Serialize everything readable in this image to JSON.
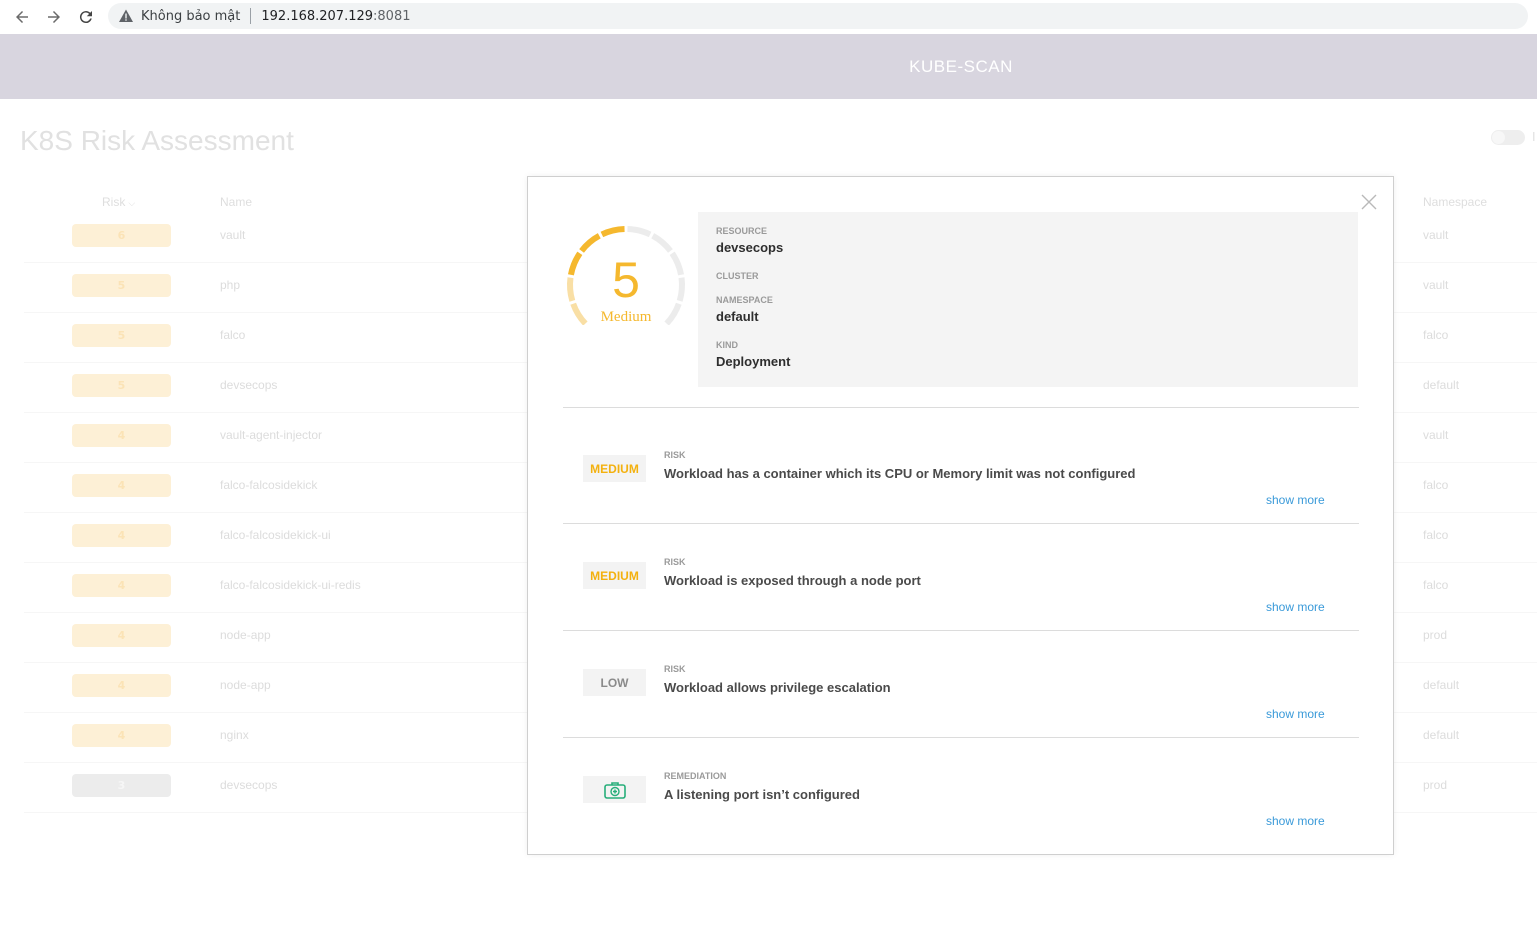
{
  "browser": {
    "security_label": "Không bảo mật",
    "url_host": "192.168.207.129",
    "url_port": ":8081"
  },
  "header": {
    "title": "KUBE-SCAN"
  },
  "page": {
    "title": "K8S Risk Assessment",
    "toggle_label": "I"
  },
  "table": {
    "columns": {
      "risk": "Risk",
      "name": "Name",
      "namespace": "Namespace"
    },
    "rows": [
      {
        "risk": "6",
        "name": "vault",
        "namespace": "vault"
      },
      {
        "risk": "5",
        "name": "php",
        "namespace": "vault"
      },
      {
        "risk": "5",
        "name": "falco",
        "namespace": "falco"
      },
      {
        "risk": "5",
        "name": "devsecops",
        "namespace": "default"
      },
      {
        "risk": "4",
        "name": "vault-agent-injector",
        "namespace": "vault"
      },
      {
        "risk": "4",
        "name": "falco-falcosidekick",
        "namespace": "falco"
      },
      {
        "risk": "4",
        "name": "falco-falcosidekick-ui",
        "namespace": "falco"
      },
      {
        "risk": "4",
        "name": "falco-falcosidekick-ui-redis",
        "namespace": "falco"
      },
      {
        "risk": "4",
        "name": "node-app",
        "namespace": "prod"
      },
      {
        "risk": "4",
        "name": "node-app",
        "namespace": "default"
      },
      {
        "risk": "4",
        "name": "nginx",
        "namespace": "default"
      },
      {
        "risk": "3",
        "name": "devsecops",
        "namespace": "prod"
      }
    ]
  },
  "modal": {
    "score": "5",
    "level": "Medium",
    "gauge_fraction": 0.5,
    "colors": {
      "accent": "#f5b82e",
      "link": "#3a9ad9",
      "remediation": "#27ae7a"
    },
    "meta": {
      "resource_label": "RESOURCE",
      "resource_value": "devsecops",
      "cluster_label": "CLUSTER",
      "namespace_label": "NAMESPACE",
      "namespace_value": "default",
      "kind_label": "KIND",
      "kind_value": "Deployment"
    },
    "items": [
      {
        "tag": "MEDIUM",
        "key": "RISK",
        "title": "Workload has a container which its CPU or Memory limit was not configured",
        "more": "show more"
      },
      {
        "tag": "MEDIUM",
        "key": "RISK",
        "title": "Workload is exposed through a node port",
        "more": "show more"
      },
      {
        "tag": "LOW",
        "key": "RISK",
        "title": "Workload allows privilege escalation",
        "more": "show more"
      },
      {
        "tag_icon": "first-aid-kit-icon",
        "key": "REMEDIATION",
        "title": "A listening port isn’t configured",
        "more": "show more"
      }
    ]
  }
}
